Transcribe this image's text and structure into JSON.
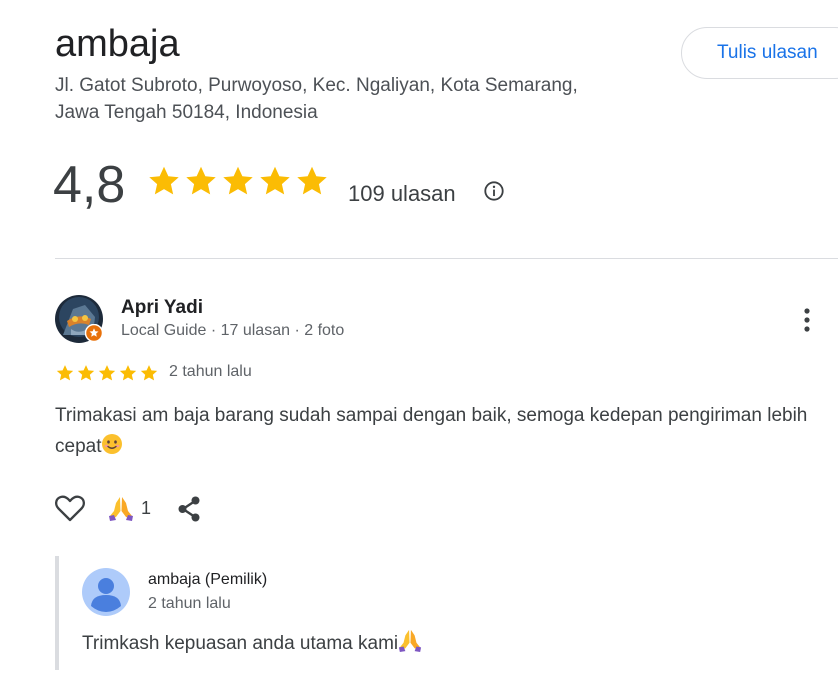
{
  "place": {
    "name": "ambaja",
    "address_line1": "Jl. Gatot Subroto, Purwoyoso, Kec. Ngaliyan, Kota Semarang,",
    "address_line2": "Jawa Tengah 50184, Indonesia"
  },
  "write_review_label": "Tulis ulasan",
  "summary": {
    "rating": "4,8",
    "stars": 5,
    "review_count": "109 ulasan",
    "info_icon": "info-icon"
  },
  "review": {
    "author": "Apri Yadi",
    "meta": "Local Guide · 17 ulasan · 2 foto",
    "stars": 5,
    "time": "2 tahun lalu",
    "text": "Trimakasi am baja barang sudah sampai dengan baik, semoga kedepan pengiriman lebih cepat",
    "reaction_count": "1",
    "icons": [
      "heart-icon",
      "praying-hands-emoji",
      "share-icon",
      "more-vert-icon"
    ]
  },
  "owner_reply": {
    "author": "ambaja (Pemilik)",
    "time": "2 tahun lalu",
    "text": "Trimkash kepuasan anda utama kami"
  },
  "colors": {
    "star": "#fbbc04",
    "link": "#1a73e8",
    "divider": "#dadce0",
    "badge": "#e8710a"
  }
}
